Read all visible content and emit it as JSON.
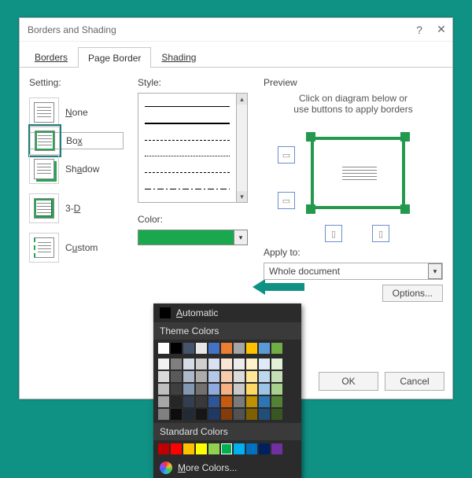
{
  "title": "Borders and Shading",
  "tabs": {
    "borders": "Borders",
    "page_border": "Page Border",
    "shading": "Shading"
  },
  "settings": {
    "label": "Setting:",
    "none": "one",
    "none_k": "N",
    "box": "Bo",
    "box_suf": "x",
    "shadow": "Sh",
    "shadow_suf": "adow",
    "threeD": "3-",
    "threeD_suf": "D",
    "custom": "C",
    "custom_suf": "ustom"
  },
  "style": {
    "label": "Style:"
  },
  "color": {
    "label": "Color:",
    "value": "#1aa84f"
  },
  "preview": {
    "label": "Preview",
    "msg1": "Click on diagram below or",
    "msg2": "use buttons to apply borders",
    "apply_label": "Apply to:",
    "apply_value": "Whole document",
    "options": "Options..."
  },
  "footer": {
    "ok": "OK",
    "cancel": "Cancel"
  },
  "picker": {
    "automatic": "Automatic",
    "automatic_key": "A",
    "theme": "Theme Colors",
    "standard": "Standard Colors",
    "more": "More Colors...",
    "more_key": "M",
    "theme_base": [
      "#ffffff",
      "#000000",
      "#44546a",
      "#e7e6e6",
      "#4472c4",
      "#ed7d31",
      "#a5a5a5",
      "#ffc000",
      "#5b9bd5",
      "#70ad47"
    ],
    "theme_rows": [
      [
        "#f2f2f2",
        "#7f7f7f",
        "#d6dce5",
        "#d0cece",
        "#d9e1f2",
        "#fbe5d6",
        "#ededed",
        "#fff2cc",
        "#deebf7",
        "#e2f0d9"
      ],
      [
        "#d9d9d9",
        "#595959",
        "#adb9ca",
        "#aeabab",
        "#b4c7e7",
        "#f8cbad",
        "#dbdbdb",
        "#ffe699",
        "#bdd7ee",
        "#c5e0b4"
      ],
      [
        "#bfbfbf",
        "#3f3f3f",
        "#8497b0",
        "#757070",
        "#8faadc",
        "#f4b183",
        "#c9c9c9",
        "#ffd966",
        "#9dc3e6",
        "#a9d18e"
      ],
      [
        "#a6a6a6",
        "#262626",
        "#333f50",
        "#3a3838",
        "#2f5597",
        "#c55a11",
        "#7b7b7b",
        "#bf9000",
        "#2e75b6",
        "#548235"
      ],
      [
        "#808080",
        "#0d0d0d",
        "#222a35",
        "#171616",
        "#1f3864",
        "#833c0c",
        "#525252",
        "#7f6000",
        "#1f4e79",
        "#385723"
      ]
    ],
    "standard_row": [
      "#c00000",
      "#ff0000",
      "#ffc000",
      "#ffff00",
      "#92d050",
      "#00b050",
      "#00b0f0",
      "#0070c0",
      "#002060",
      "#7030a0"
    ]
  }
}
